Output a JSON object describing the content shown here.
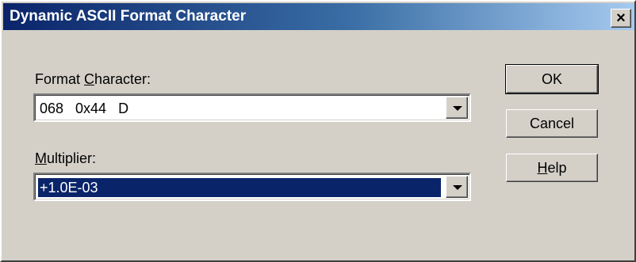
{
  "window": {
    "title": "Dynamic ASCII Format Character",
    "close_glyph": "×"
  },
  "format_character": {
    "label_pre": "Format ",
    "label_accel": "C",
    "label_post": "haracter:",
    "value": "068   0x44   D"
  },
  "multiplier": {
    "label_pre": "",
    "label_accel": "M",
    "label_post": "ultiplier:",
    "value": "+1.0E-03"
  },
  "buttons": {
    "ok": "OK",
    "cancel": "Cancel",
    "help_accel": "H",
    "help_rest": "elp"
  },
  "colors": {
    "title_start": "#0a246a",
    "title_end": "#a6caf0",
    "dialog_face": "#d4d0c8",
    "selection": "#0a246a"
  }
}
